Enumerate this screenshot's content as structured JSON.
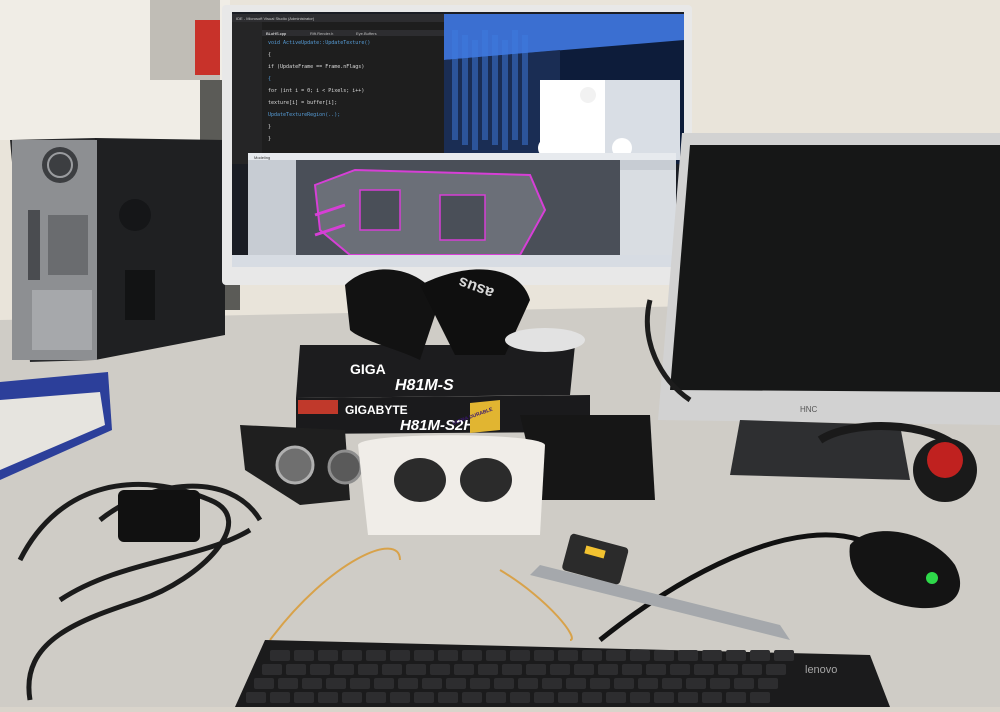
{
  "scene": {
    "background_wall": "#e6e1d8",
    "desk_color": "#c9c6c0"
  },
  "monitor_main": {
    "ide_titlebar": "IDE - Microsoft Visual Studio (Administrator)",
    "ide_tab_1": "BLoHS.cpp",
    "ide_tab_2": "Rift.Render.h",
    "ide_tab_3": "Eye.Buffers",
    "code_lines": [
      "void ActiveUpdate::UpdateTexture()",
      "{",
      "  if (UpdateFrame == Frame.nFlags)",
      "  {",
      "    for (int i = 0; i < Pixels; i++)",
      "      texture[i] = buffer[i];",
      "    UpdateTextureRegion(..);",
      "  }",
      "}"
    ],
    "cad_tab": "Modeling"
  },
  "gigabyte_box": {
    "brand": "GIGABYTE",
    "model": "H81M-S2H",
    "badge": "ULTRA DURABLE"
  },
  "gigabyte_box_top": {
    "brand": "GIGA",
    "model": "H81M-S"
  },
  "headset_strap": {
    "brand": "asus"
  },
  "monitor_second": {
    "brand": "HNC"
  },
  "keyboard": {
    "brand": "lenovo"
  },
  "icons": [
    "pc-tower",
    "monitor",
    "vr-headset",
    "keyboard",
    "mouse",
    "caliper",
    "headphones",
    "cables"
  ]
}
